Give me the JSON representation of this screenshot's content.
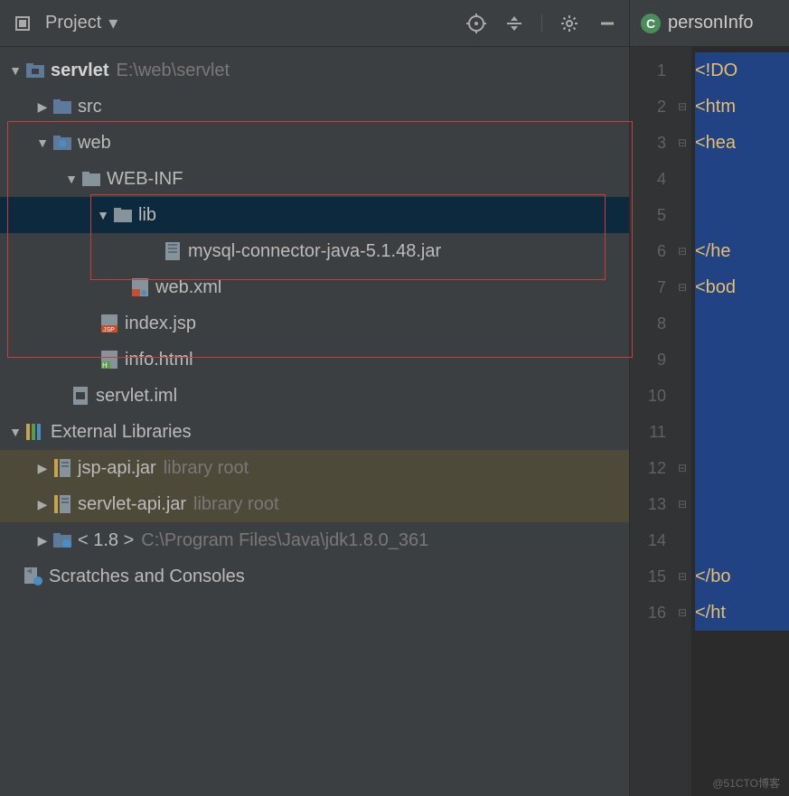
{
  "toolbar": {
    "project_label": "Project"
  },
  "tree": {
    "root": {
      "name": "servlet",
      "path": "E:\\web\\servlet"
    },
    "src": "src",
    "web": "web",
    "webinf": "WEB-INF",
    "lib": "lib",
    "mysql_jar": "mysql-connector-java-5.1.48.jar",
    "webxml": "web.xml",
    "indexjsp": "index.jsp",
    "infohtml": "info.html",
    "servletiml": "servlet.iml",
    "external_libs": "External Libraries",
    "jsp_api": "jsp-api.jar",
    "servlet_api": "servlet-api.jar",
    "library_root": "library root",
    "jdk_label": "< 1.8 >",
    "jdk_path": "C:\\Program Files\\Java\\jdk1.8.0_361",
    "scratches": "Scratches and Consoles"
  },
  "editor": {
    "tab_name": "personInfo",
    "tab_icon_letter": "C",
    "lines": [
      "1",
      "2",
      "3",
      "4",
      "5",
      "6",
      "7",
      "8",
      "9",
      "10",
      "11",
      "12",
      "13",
      "14",
      "15",
      "16"
    ],
    "code": {
      "l1": "<!DO",
      "l2": "<htm",
      "l3": "<hea",
      "l6": "</he",
      "l7": "<bod",
      "l15": "</bo",
      "l16": "</ht"
    }
  },
  "watermark": "@51CTO博客"
}
